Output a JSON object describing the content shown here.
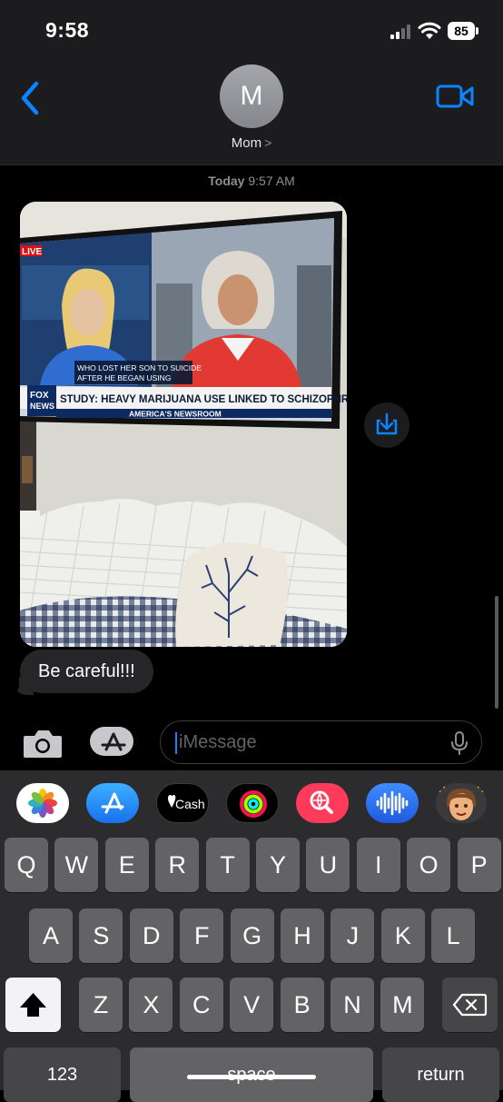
{
  "status_bar": {
    "time": "9:58",
    "battery": "85"
  },
  "header": {
    "avatar_initial": "M",
    "contact_name": "Mom",
    "contact_chevron": ">"
  },
  "conversation": {
    "timestamp_day": "Today",
    "timestamp_time": "9:57 AM",
    "photo_message": {
      "tv_live_badge": "LIVE",
      "tv_caption_line1": "WHO LOST HER SON TO SUICIDE",
      "tv_caption_line2": "AFTER HE BEGAN USING",
      "tv_headline": "STUDY: HEAVY MARIJUANA USE LINKED TO SCHIZOPHRENIA",
      "tv_show": "AMERICA'S NEWSROOM",
      "tv_logo_line1": "FOX",
      "tv_logo_line2": "NEWS"
    },
    "text_message": "Be careful!!!"
  },
  "compose": {
    "placeholder": "iMessage"
  },
  "app_drawer": [
    {
      "name": "photos-app-icon"
    },
    {
      "name": "app-store-app-icon"
    },
    {
      "name": "cash-app-icon",
      "label": "Cash"
    },
    {
      "name": "fitness-app-icon"
    },
    {
      "name": "web-images-app-icon"
    },
    {
      "name": "audio-message-app-icon"
    },
    {
      "name": "memoji-app-icon"
    }
  ],
  "keyboard": {
    "row1": [
      "Q",
      "W",
      "E",
      "R",
      "T",
      "Y",
      "U",
      "I",
      "O",
      "P"
    ],
    "row2": [
      "A",
      "S",
      "D",
      "F",
      "G",
      "H",
      "J",
      "K",
      "L"
    ],
    "row3": [
      "Z",
      "X",
      "C",
      "V",
      "B",
      "N",
      "M"
    ],
    "numbers_label": "123",
    "space_label": "space",
    "return_label": "return"
  },
  "colors": {
    "accent": "#0a84ff",
    "bubble": "#262628",
    "keyboard_bg": "#2c2c2e",
    "key": "#636366"
  }
}
